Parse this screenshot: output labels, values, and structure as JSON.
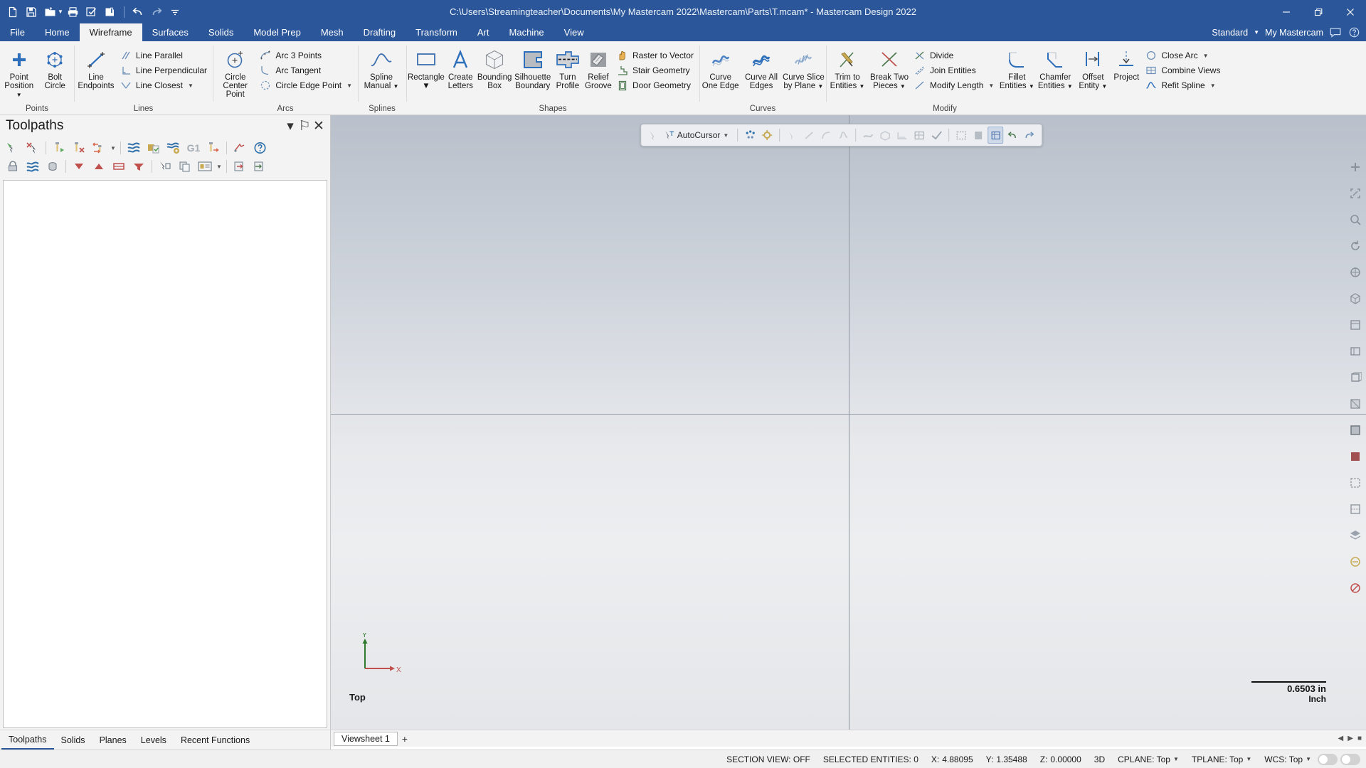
{
  "titlebar": {
    "document_title": "C:\\Users\\Streamingteacher\\Documents\\My Mastercam 2022\\Mastercam\\Parts\\T.mcam* - Mastercam Design 2022",
    "quick_access": [
      {
        "name": "new-file-icon",
        "label": "New"
      },
      {
        "name": "save-icon",
        "label": "Save"
      },
      {
        "name": "open-folder-icon",
        "label": "Open"
      },
      {
        "name": "print-icon",
        "label": "Print"
      },
      {
        "name": "print-preview-icon",
        "label": "Print Preview"
      },
      {
        "name": "zip2go-icon",
        "label": "Zip2Go"
      },
      {
        "name": "undo-icon",
        "label": "Undo"
      },
      {
        "name": "redo-icon",
        "label": "Redo"
      },
      {
        "name": "customize-qat-icon",
        "label": "Customize Quick Access Toolbar"
      }
    ],
    "window_buttons": [
      {
        "name": "minimize-button",
        "label": "Minimize"
      },
      {
        "name": "restore-button",
        "label": "Restore"
      },
      {
        "name": "close-button",
        "label": "Close"
      }
    ]
  },
  "tabs": [
    {
      "label": "File",
      "active": false
    },
    {
      "label": "Home",
      "active": false
    },
    {
      "label": "Wireframe",
      "active": true
    },
    {
      "label": "Surfaces",
      "active": false
    },
    {
      "label": "Solids",
      "active": false
    },
    {
      "label": "Model Prep",
      "active": false
    },
    {
      "label": "Mesh",
      "active": false
    },
    {
      "label": "Drafting",
      "active": false
    },
    {
      "label": "Transform",
      "active": false
    },
    {
      "label": "Art",
      "active": false
    },
    {
      "label": "Machine",
      "active": false
    },
    {
      "label": "View",
      "active": false
    }
  ],
  "tabbar_right": {
    "config": "Standard",
    "account": "My Mastercam",
    "help_icon": "help-icon",
    "chat_icon": "comment-icon"
  },
  "ribbon": {
    "groups": [
      {
        "label": "Points",
        "big": [
          {
            "name": "point-position-button",
            "label": "Point",
            "label2": "Position",
            "caret": true,
            "icon": "plus-icon"
          },
          {
            "name": "bolt-circle-button",
            "label": "Bolt",
            "label2": "Circle",
            "caret": false,
            "icon": "bolt-circle-icon"
          }
        ],
        "small": []
      },
      {
        "label": "Lines",
        "big": [
          {
            "name": "line-endpoints-button",
            "label": "Line",
            "label2": "Endpoints",
            "caret": false,
            "icon": "line-endpoints-icon"
          }
        ],
        "small": [
          {
            "name": "line-parallel-button",
            "label": "Line Parallel",
            "caret": false,
            "icon": "line-parallel-icon"
          },
          {
            "name": "line-perpendicular-button",
            "label": "Line Perpendicular",
            "caret": false,
            "icon": "line-perpendicular-icon"
          },
          {
            "name": "line-closest-button",
            "label": "Line Closest",
            "caret": true,
            "icon": "line-closest-icon"
          }
        ]
      },
      {
        "label": "Arcs",
        "big": [
          {
            "name": "circle-center-point-button",
            "label": "Circle",
            "label2": "Center Point",
            "caret": false,
            "icon": "circle-center-icon"
          }
        ],
        "small": [
          {
            "name": "arc-3-points-button",
            "label": "Arc 3 Points",
            "caret": false,
            "icon": "arc-3-points-icon"
          },
          {
            "name": "arc-tangent-button",
            "label": "Arc Tangent",
            "caret": false,
            "icon": "arc-tangent-icon"
          },
          {
            "name": "circle-edge-point-button",
            "label": "Circle Edge Point",
            "caret": true,
            "icon": "circle-edge-icon"
          }
        ]
      },
      {
        "label": "Splines",
        "big": [
          {
            "name": "spline-manual-button",
            "label": "Spline",
            "label2": "Manual",
            "caret": true,
            "icon": "spline-icon"
          }
        ],
        "small": []
      },
      {
        "label": "Shapes",
        "big": [
          {
            "name": "rectangle-button",
            "label": "Rectangle",
            "label2": "",
            "caret": true,
            "icon": "rectangle-icon"
          },
          {
            "name": "create-letters-button",
            "label": "Create",
            "label2": "Letters",
            "caret": false,
            "icon": "letter-a-icon"
          },
          {
            "name": "bounding-box-button",
            "label": "Bounding",
            "label2": "Box",
            "caret": false,
            "icon": "bounding-box-icon"
          },
          {
            "name": "silhouette-boundary-button",
            "label": "Silhouette",
            "label2": "Boundary",
            "caret": false,
            "icon": "silhouette-boundary-icon"
          },
          {
            "name": "turn-profile-button",
            "label": "Turn",
            "label2": "Profile",
            "caret": false,
            "icon": "turn-profile-icon"
          },
          {
            "name": "relief-groove-button",
            "label": "Relief",
            "label2": "Groove",
            "caret": false,
            "icon": "relief-groove-icon"
          }
        ],
        "small": [
          {
            "name": "raster-to-vector-button",
            "label": "Raster to Vector",
            "caret": false,
            "icon": "raster-to-vector-icon"
          },
          {
            "name": "stair-geometry-button",
            "label": "Stair Geometry",
            "caret": false,
            "icon": "stair-geometry-icon"
          },
          {
            "name": "door-geometry-button",
            "label": "Door Geometry",
            "caret": false,
            "icon": "door-geometry-icon"
          }
        ]
      },
      {
        "label": "Curves",
        "big": [
          {
            "name": "curve-one-edge-button",
            "label": "Curve",
            "label2": "One Edge",
            "caret": false,
            "icon": "curve-one-edge-icon"
          },
          {
            "name": "curve-all-edges-button",
            "label": "Curve All",
            "label2": "Edges",
            "caret": false,
            "icon": "curve-all-edges-icon"
          },
          {
            "name": "curve-slice-by-plane-button",
            "label": "Curve Slice",
            "label2": "by Plane",
            "caret": true,
            "icon": "curve-slice-icon"
          }
        ],
        "small": []
      },
      {
        "label": "Modify",
        "big": [
          {
            "name": "trim-to-entities-button",
            "label": "Trim to",
            "label2": "Entities",
            "caret": true,
            "icon": "trim-icon"
          },
          {
            "name": "break-two-pieces-button",
            "label": "Break Two",
            "label2": "Pieces",
            "caret": true,
            "icon": "break-icon"
          }
        ],
        "small": [
          {
            "name": "divide-button",
            "label": "Divide",
            "caret": false,
            "icon": "divide-icon"
          },
          {
            "name": "join-entities-button",
            "label": "Join Entities",
            "caret": false,
            "icon": "join-entities-icon"
          },
          {
            "name": "modify-length-button",
            "label": "Modify Length",
            "caret": true,
            "icon": "modify-length-icon"
          }
        ],
        "big2": [
          {
            "name": "fillet-entities-button",
            "label": "Fillet",
            "label2": "Entities",
            "caret": true,
            "icon": "fillet-icon"
          },
          {
            "name": "chamfer-entities-button",
            "label": "Chamfer",
            "label2": "Entities",
            "caret": true,
            "icon": "chamfer-icon"
          },
          {
            "name": "offset-entity-button",
            "label": "Offset",
            "label2": "Entity",
            "caret": true,
            "icon": "offset-icon"
          },
          {
            "name": "project-button",
            "label": "Project",
            "label2": "",
            "caret": false,
            "icon": "project-icon"
          }
        ],
        "small2": [
          {
            "name": "close-arc-button",
            "label": "Close Arc",
            "caret": true,
            "icon": "close-arc-icon"
          },
          {
            "name": "combine-views-button",
            "label": "Combine Views",
            "caret": false,
            "icon": "combine-views-icon"
          },
          {
            "name": "refit-spline-button",
            "label": "Refit Spline",
            "caret": true,
            "icon": "refit-spline-icon"
          }
        ]
      }
    ]
  },
  "toolpaths_panel": {
    "title": "Toolpaths",
    "header_buttons": [
      {
        "name": "panel-menu-icon",
        "glyph": "▾"
      },
      {
        "name": "panel-pin-icon",
        "glyph": "⚐"
      },
      {
        "name": "panel-close-icon",
        "glyph": "✕"
      }
    ],
    "toolbar_row1": [
      {
        "name": "select-all-toolpaths-icon"
      },
      {
        "name": "deselect-all-toolpaths-icon"
      },
      {
        "name": "regenerate-selected-icon"
      },
      {
        "name": "regenerate-invalid-icon"
      },
      {
        "name": "regenerate-dirty-icon"
      },
      {
        "name": "regenerate-options-caret-icon"
      },
      {
        "name": "simulate-toolpath-icon"
      },
      {
        "name": "verify-toolpath-icon"
      },
      {
        "name": "machine-simulation-icon"
      },
      {
        "name": "g1-backplot-icon"
      },
      {
        "name": "post-selected-icon"
      },
      {
        "name": "high-speed-toolpath-icon"
      },
      {
        "name": "help-icon"
      }
    ],
    "toolbar_row2": [
      {
        "name": "lock-toolpath-icon"
      },
      {
        "name": "toggle-display-icon"
      },
      {
        "name": "toggle-posting-icon"
      },
      {
        "name": "filter-down-icon"
      },
      {
        "name": "filter-up-icon"
      },
      {
        "name": "filter-list-icon"
      },
      {
        "name": "filter-options-icon"
      },
      {
        "name": "move-to-folder-icon"
      },
      {
        "name": "copy-toolpath-icon"
      },
      {
        "name": "toolpath-group-icon"
      },
      {
        "name": "toolpath-group-caret-icon"
      },
      {
        "name": "import-toolpath-icon"
      },
      {
        "name": "export-toolpath-icon"
      }
    ],
    "tabs": [
      {
        "label": "Toolpaths",
        "active": true
      },
      {
        "label": "Solids",
        "active": false
      },
      {
        "label": "Planes",
        "active": false
      },
      {
        "label": "Levels",
        "active": false
      },
      {
        "label": "Recent Functions",
        "active": false
      }
    ]
  },
  "selection_bar": {
    "autocursor_label": "AutoCursor",
    "buttons": [
      {
        "name": "select-entity-icon"
      },
      {
        "name": "autocursor-icon"
      },
      {
        "name": "autocursor-settings-caret"
      },
      {
        "name": "quick-mask-all-icon"
      },
      {
        "name": "quick-mask-settings-icon"
      },
      {
        "name": "select-points-icon"
      },
      {
        "name": "select-lines-icon"
      },
      {
        "name": "select-arcs-icon"
      },
      {
        "name": "select-splines-icon"
      },
      {
        "name": "select-surfaces-icon"
      },
      {
        "name": "select-solids-icon"
      },
      {
        "name": "select-drafting-icon"
      },
      {
        "name": "select-all-mask-icon"
      },
      {
        "name": "select-only-mask-icon"
      },
      {
        "name": "wireframe-display-icon"
      },
      {
        "name": "shaded-display-icon"
      },
      {
        "name": "analyze-entity-icon"
      },
      {
        "name": "undo-selection-icon"
      },
      {
        "name": "clear-selection-icon"
      }
    ]
  },
  "view_toolbar": [
    {
      "name": "zoom-in-icon"
    },
    {
      "name": "fit-to-window-icon"
    },
    {
      "name": "zoom-window-icon"
    },
    {
      "name": "dynamic-rotate-icon"
    },
    {
      "name": "pan-icon"
    },
    {
      "name": "isometric-view-icon"
    },
    {
      "name": "top-view-icon"
    },
    {
      "name": "front-view-icon"
    },
    {
      "name": "right-view-icon"
    },
    {
      "name": "wireframe-shade-icon"
    },
    {
      "name": "shaded-with-edges-icon"
    },
    {
      "name": "shaded-only-icon"
    },
    {
      "name": "translucency-icon"
    },
    {
      "name": "hidden-lines-icon"
    },
    {
      "name": "levels-icon"
    },
    {
      "name": "blank-entity-icon"
    },
    {
      "name": "unblank-entity-icon"
    }
  ],
  "graphics": {
    "view_label": "Top",
    "gnomon": {
      "x_label": "X",
      "y_label": "Y"
    },
    "scale_value": "0.6503 in",
    "scale_unit": "Inch"
  },
  "viewsheets": {
    "tabs": [
      {
        "label": "Viewsheet 1",
        "active": true
      }
    ],
    "add_label": "+",
    "nav": [
      "◀",
      "▶",
      "■"
    ]
  },
  "statusbar": {
    "section_view": "SECTION VIEW: OFF",
    "selected_entities": "SELECTED ENTITIES: 0",
    "x_label": "X:",
    "x_value": "4.88095",
    "y_label": "Y:",
    "y_value": "1.35488",
    "z_label": "Z:",
    "z_value": "0.00000",
    "dimension_mode": "3D",
    "cplane": "CPLANE: Top",
    "tplane": "TPLANE: Top",
    "wcs": "WCS: Top"
  },
  "colors": {
    "brand_blue": "#2b579a",
    "ribbon_bg": "#f3f3f3",
    "icon_blue": "#2e6fbb",
    "accent_red": "#c0504d",
    "accent_green": "#4f7a52",
    "gold": "#c8a951"
  }
}
